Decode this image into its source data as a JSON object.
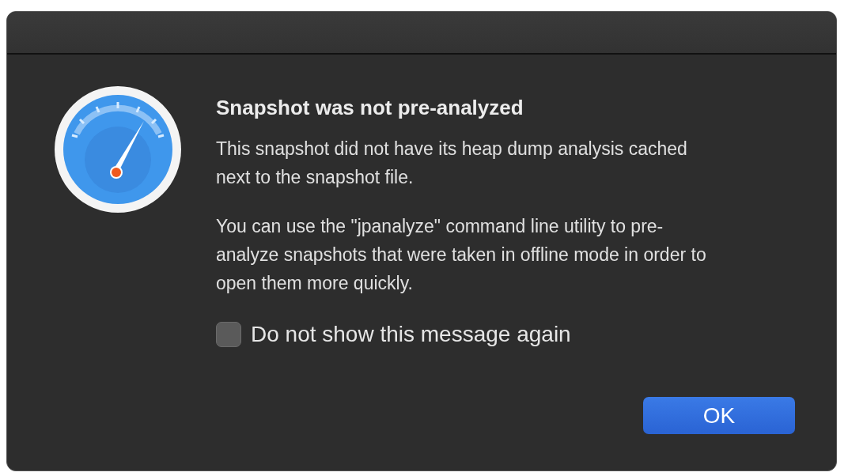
{
  "dialog": {
    "title": "Snapshot was not pre-analyzed",
    "paragraphs": [
      "This snapshot did not have its heap dump analysis cached next to the snapshot file.",
      "You can use the \"jpanalyze\" command line utility to pre-analyze snapshots that were taken in offline mode in order to open them more quickly."
    ],
    "checkbox": {
      "label": "Do not show this message again",
      "checked": false
    },
    "buttons": [
      {
        "label": "OK",
        "default": true
      }
    ]
  }
}
